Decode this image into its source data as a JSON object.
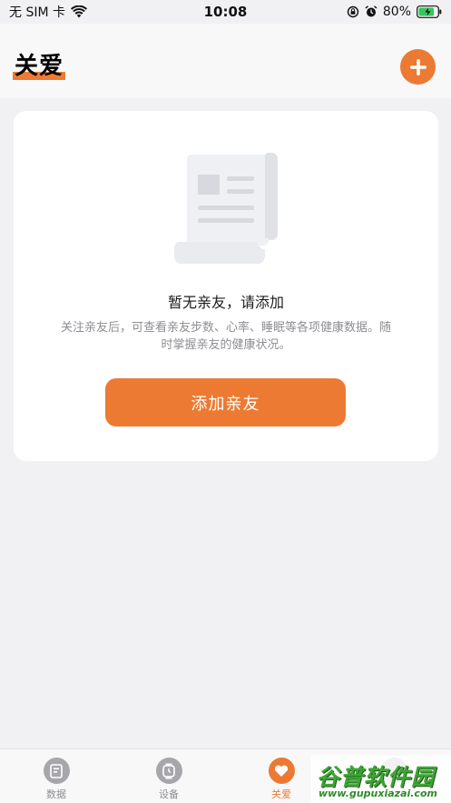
{
  "status_bar": {
    "carrier": "无 SIM 卡",
    "time": "10:08",
    "battery": "80%"
  },
  "header": {
    "title": "关爱"
  },
  "empty_state": {
    "title": "暂无亲友，请添加",
    "description": "关注亲友后，可查看亲友步数、心率、睡眠等各项健康数据。随时掌握亲友的健康状况。",
    "button_label": "添加亲友"
  },
  "tabs": [
    {
      "label": "数据",
      "icon": "data-icon",
      "active": false
    },
    {
      "label": "设备",
      "icon": "watch-icon",
      "active": false
    },
    {
      "label": "关爱",
      "icon": "heart-icon",
      "active": true
    },
    {
      "label": "",
      "icon": "hidden-tab-icon",
      "active": false
    }
  ],
  "watermark": {
    "brand": "谷普软件园",
    "url": "www.gupuxiazai.com"
  },
  "colors": {
    "accent": "#ec7a32",
    "background": "#f1f1f4",
    "card": "#ffffff",
    "muted_text": "#8e8e93"
  }
}
